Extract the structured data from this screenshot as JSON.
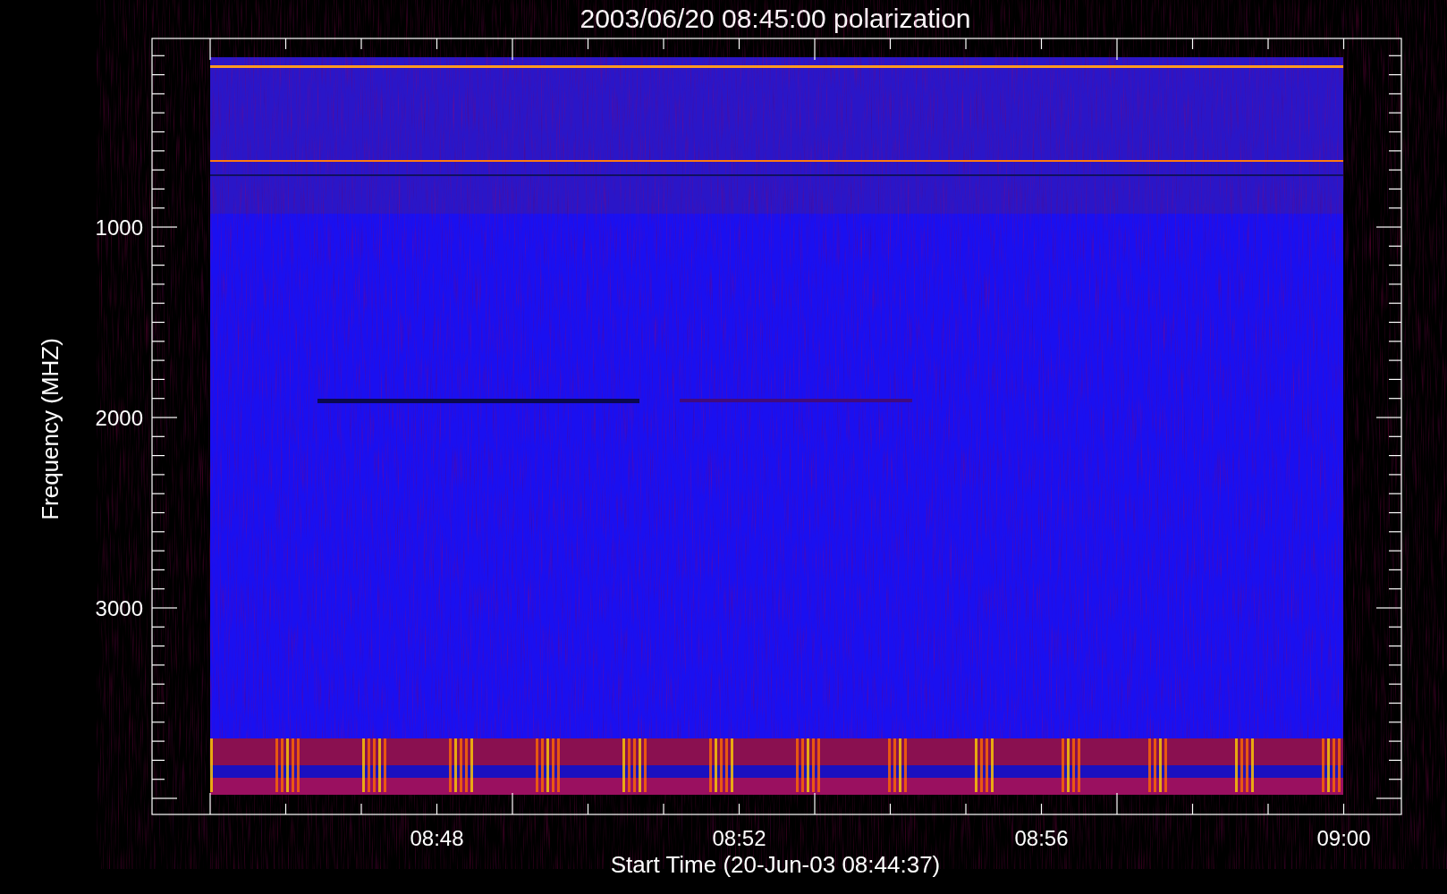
{
  "title": "2003/06/20 08:45:00 polarization",
  "x_axis": {
    "label": "Start Time (20-Jun-03 08:44:37)",
    "ticks": [
      "08:48",
      "08:52",
      "08:56",
      "09:00"
    ]
  },
  "y_axis": {
    "label": "Frequency (MHZ)",
    "ticks": [
      "1000",
      "2000",
      "3000"
    ]
  }
}
